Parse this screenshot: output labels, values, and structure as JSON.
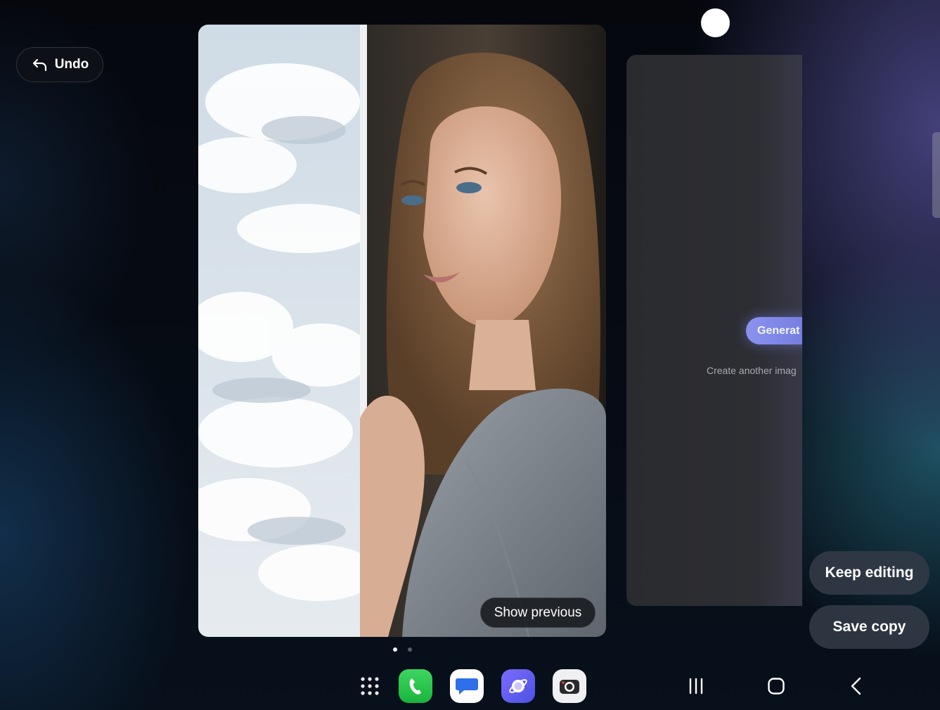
{
  "toolbar": {
    "undo_label": "Undo"
  },
  "preview": {
    "show_previous_label": "Show previous",
    "page_indicator": {
      "count": 2,
      "active_index": 0
    }
  },
  "side_panel": {
    "generate_label": "Generat",
    "create_another_text": "Create another imag"
  },
  "actions": {
    "keep_editing_label": "Keep editing",
    "save_copy_label": "Save copy"
  },
  "dock": {
    "apps": [
      {
        "name": "apps-grid-icon"
      },
      {
        "name": "phone-icon"
      },
      {
        "name": "messages-icon"
      },
      {
        "name": "internet-icon"
      },
      {
        "name": "camera-icon"
      }
    ]
  },
  "navigation": {
    "buttons": [
      "recents-icon",
      "home-icon",
      "back-icon"
    ]
  },
  "colors": {
    "accent_generate": "#7b82e6",
    "pill_background": "#323a46",
    "phone_green": "#21c247",
    "internet_purple": "#6a5cf0"
  }
}
